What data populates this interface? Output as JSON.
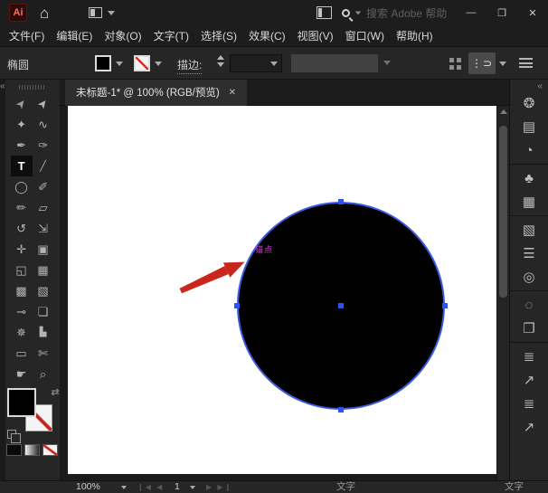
{
  "titlebar": {
    "logo_text": "Ai",
    "home_icon": "⌂",
    "search_placeholder": "搜索 Adobe 帮助",
    "window": {
      "minimize": "—",
      "maximize": "❐",
      "close": "✕"
    }
  },
  "menubar": {
    "items": [
      "文件(F)",
      "编辑(E)",
      "对象(O)",
      "文字(T)",
      "选择(S)",
      "效果(C)",
      "视图(V)",
      "窗口(W)",
      "帮助(H)"
    ]
  },
  "controlbar": {
    "context_label": "椭圆",
    "stroke_label": "描边:",
    "panel_button_glyph": "⋮⊃",
    "fill_color": "#000000",
    "stroke_style": "none"
  },
  "tabbar": {
    "title": "未标题-1* @ 100% (RGB/预览)",
    "close": "✕"
  },
  "toolbar": {
    "collapse": "«",
    "tools": [
      {
        "name": "selection-tool",
        "glyph": "➤"
      },
      {
        "name": "direct-selection-tool",
        "glyph": "➤"
      },
      {
        "name": "magic-wand-tool",
        "glyph": "✦"
      },
      {
        "name": "lasso-tool",
        "glyph": "∿"
      },
      {
        "name": "pen-tool",
        "glyph": "✒"
      },
      {
        "name": "curvature-tool",
        "glyph": "✑"
      },
      {
        "name": "type-tool",
        "glyph": "T",
        "selected": true
      },
      {
        "name": "line-segment-tool",
        "glyph": "╱"
      },
      {
        "name": "ellipse-tool",
        "glyph": "◯"
      },
      {
        "name": "paintbrush-tool",
        "glyph": "✐"
      },
      {
        "name": "pencil-tool",
        "glyph": "✏"
      },
      {
        "name": "eraser-tool",
        "glyph": "▱"
      },
      {
        "name": "rotate-tool",
        "glyph": "↺"
      },
      {
        "name": "scale-tool",
        "glyph": "⇲"
      },
      {
        "name": "puppet-warp-tool",
        "glyph": "✛"
      },
      {
        "name": "free-transform-tool",
        "glyph": "▣"
      },
      {
        "name": "shape-builder-tool",
        "glyph": "◱"
      },
      {
        "name": "perspective-grid-tool",
        "glyph": "▦"
      },
      {
        "name": "mesh-tool",
        "glyph": "▩"
      },
      {
        "name": "gradient-tool",
        "glyph": "▧"
      },
      {
        "name": "eyedropper-tool",
        "glyph": "⊸"
      },
      {
        "name": "blend-tool",
        "glyph": "❏"
      },
      {
        "name": "symbol-sprayer-tool",
        "glyph": "✵"
      },
      {
        "name": "graph-tool",
        "glyph": "▙"
      },
      {
        "name": "artboard-tool",
        "glyph": "▭"
      },
      {
        "name": "slice-tool",
        "glyph": "✄"
      },
      {
        "name": "hand-tool",
        "glyph": "☛"
      },
      {
        "name": "zoom-tool",
        "glyph": "⌕"
      }
    ],
    "swap_icon": "⇄"
  },
  "canvas": {
    "smart_guide_label": "锚点",
    "shape": {
      "type": "circle",
      "fill": "#000000",
      "selection_stroke": "#3a5ce0"
    }
  },
  "right_panel": {
    "collapse": "«",
    "icons": [
      {
        "name": "color-panel-icon",
        "glyph": "❂"
      },
      {
        "name": "color-guide-panel-icon",
        "glyph": "▤"
      },
      {
        "name": "libraries-panel-icon",
        "glyph": "◔"
      },
      {
        "name": "separator"
      },
      {
        "name": "symbols-panel-icon",
        "glyph": "♣"
      },
      {
        "name": "swatches-panel-icon",
        "glyph": "▦"
      },
      {
        "name": "separator"
      },
      {
        "name": "gradient-panel-icon",
        "glyph": "▧"
      },
      {
        "name": "stroke-panel-icon",
        "glyph": "☰"
      },
      {
        "name": "transparency-panel-icon",
        "glyph": "◎"
      },
      {
        "name": "separator"
      },
      {
        "name": "image-trace-panel-icon",
        "glyph": "◌"
      },
      {
        "name": "artboards-panel-icon",
        "glyph": "❐"
      },
      {
        "name": "separator"
      },
      {
        "name": "layers-panel-icon",
        "glyph": "≣"
      },
      {
        "name": "asset-export-panel-icon",
        "glyph": "↗"
      },
      {
        "name": "layers-panel-icon-2",
        "glyph": "≣"
      },
      {
        "name": "asset-export-panel-icon-2",
        "glyph": "↗"
      }
    ]
  },
  "statusbar": {
    "zoom": "100%",
    "nav_back": "❙◀ ◀",
    "artboard_number": "1",
    "nav_forward": "▶ ▶❙",
    "tool_name": "文字",
    "tool_name_right": "文字"
  },
  "colors": {
    "selection_blue": "#3a5ce0",
    "anchor_blue": "#2b55f0",
    "smart_guide_magenta": "#d43bd4",
    "annotation_red": "#c9271b",
    "none_slash_red": "#d3281e"
  }
}
